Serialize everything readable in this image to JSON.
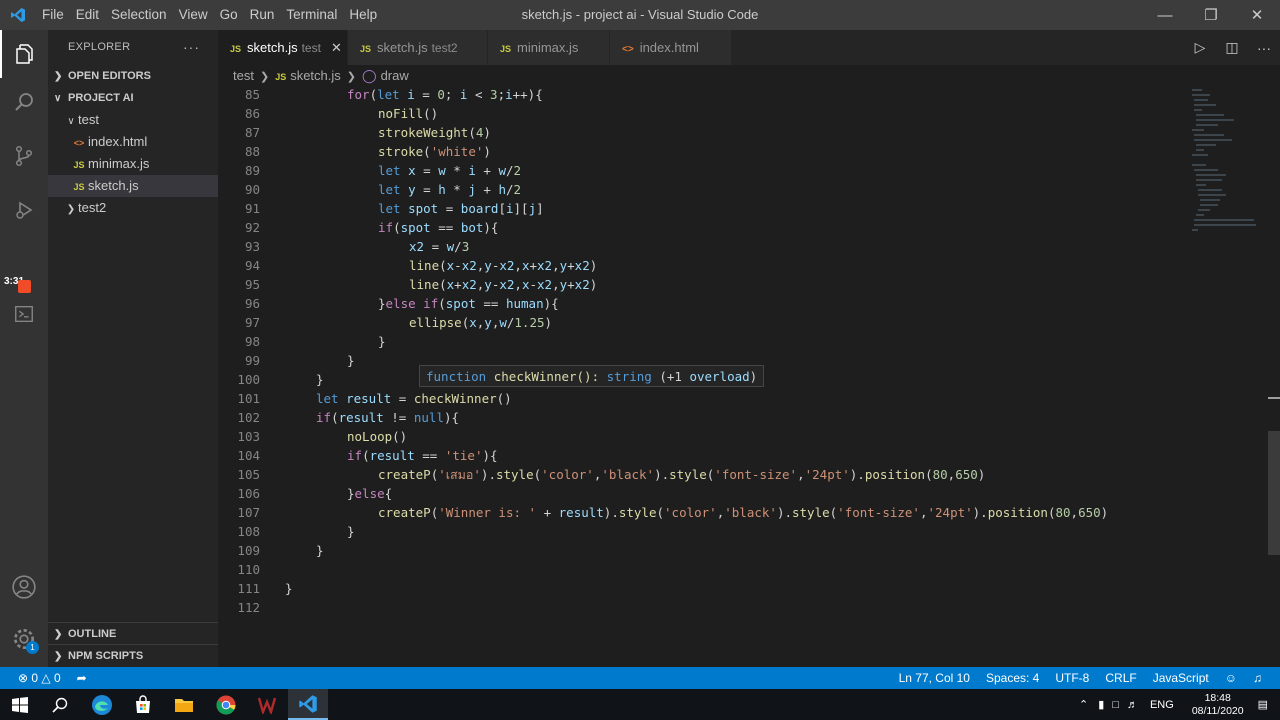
{
  "titlebar": {
    "menu": [
      "File",
      "Edit",
      "Selection",
      "View",
      "Go",
      "Run",
      "Terminal",
      "Help"
    ],
    "title": "sketch.js - project ai - Visual Studio Code"
  },
  "activitybar": {
    "icons": [
      "explorer-icon",
      "search-icon",
      "source-control-icon",
      "run-debug-icon",
      "extensions-icon",
      "account-icon",
      "manage-gear-icon"
    ],
    "recording_timer": "3:31"
  },
  "sidebar": {
    "title": "EXPLORER",
    "open_editors": "OPEN EDITORS",
    "project": "PROJECT AI",
    "folder_test": "test",
    "files": [
      {
        "name": "index.html",
        "type": "html"
      },
      {
        "name": "minimax.js",
        "type": "js"
      },
      {
        "name": "sketch.js",
        "type": "js"
      }
    ],
    "folder_test2": "test2",
    "outline": "OUTLINE",
    "npm_scripts": "NPM SCRIPTS"
  },
  "tabs": [
    {
      "name": "sketch.js",
      "desc": "test",
      "active": true
    },
    {
      "name": "sketch.js",
      "desc": "test2",
      "active": false
    },
    {
      "name": "minimax.js",
      "desc": "",
      "active": false
    },
    {
      "name": "index.html",
      "desc": "",
      "active": false
    }
  ],
  "breadcrumbs": {
    "folder": "test",
    "file": "sketch.js",
    "symbol": "draw"
  },
  "editor": {
    "hover": {
      "kw": "function",
      "sig": " checkWinner(): ",
      "type": "string",
      "rest": " (+1 ",
      "overload": "overload",
      "close": ")"
    },
    "lines": [
      {
        "n": "85"
      },
      {
        "n": "86"
      },
      {
        "n": "87"
      },
      {
        "n": "88"
      },
      {
        "n": "89"
      },
      {
        "n": "90"
      },
      {
        "n": "91"
      },
      {
        "n": "92"
      },
      {
        "n": "93"
      },
      {
        "n": "94"
      },
      {
        "n": "95"
      },
      {
        "n": "96"
      },
      {
        "n": "97"
      },
      {
        "n": "98"
      },
      {
        "n": "99"
      },
      {
        "n": "100"
      },
      {
        "n": "101"
      },
      {
        "n": "102"
      },
      {
        "n": "103"
      },
      {
        "n": "104"
      },
      {
        "n": "105"
      },
      {
        "n": "106"
      },
      {
        "n": "107"
      },
      {
        "n": "108"
      },
      {
        "n": "109"
      },
      {
        "n": "110"
      },
      {
        "n": "111"
      },
      {
        "n": "112"
      }
    ]
  },
  "statusbar": {
    "errors": "0",
    "warnings": "0",
    "position": "Ln 77, Col 10",
    "spaces": "Spaces: 4",
    "encoding": "UTF-8",
    "eol": "CRLF",
    "language": "JavaScript"
  },
  "taskbar": {
    "time": "18:48",
    "date": "08/11/2020",
    "lang": "ENG"
  },
  "colors": {
    "accent": "#007acc",
    "keyword": "#569cd6",
    "control": "#c586c0",
    "string": "#ce9178",
    "function": "#dcdcaa"
  }
}
